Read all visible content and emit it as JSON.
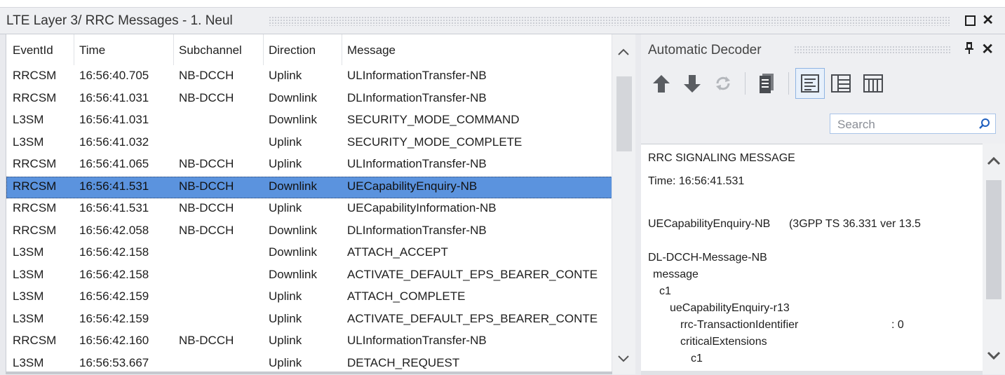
{
  "window": {
    "title": "LTE Layer 3/ RRC Messages - 1. Neul",
    "restore_icon": "restore-icon",
    "close_icon": "close-icon"
  },
  "grid": {
    "columns": [
      "EventId",
      "Time",
      "Subchannel",
      "Direction",
      "Message"
    ],
    "rows": [
      {
        "event": "RRCSM",
        "time": "16:56:40.705",
        "sub": "NB-DCCH",
        "dir": "Uplink",
        "msg": "ULInformationTransfer-NB"
      },
      {
        "event": "RRCSM",
        "time": "16:56:41.031",
        "sub": "NB-DCCH",
        "dir": "Downlink",
        "msg": "DLInformationTransfer-NB"
      },
      {
        "event": "L3SM",
        "time": "16:56:41.031",
        "sub": "",
        "dir": "Downlink",
        "msg": "SECURITY_MODE_COMMAND"
      },
      {
        "event": "L3SM",
        "time": "16:56:41.032",
        "sub": "",
        "dir": "Uplink",
        "msg": "SECURITY_MODE_COMPLETE"
      },
      {
        "event": "RRCSM",
        "time": "16:56:41.065",
        "sub": "NB-DCCH",
        "dir": "Uplink",
        "msg": "ULInformationTransfer-NB"
      },
      {
        "event": "RRCSM",
        "time": "16:56:41.531",
        "sub": "NB-DCCH",
        "dir": "Downlink",
        "msg": "UECapabilityEnquiry-NB",
        "selected": true
      },
      {
        "event": "RRCSM",
        "time": "16:56:41.531",
        "sub": "NB-DCCH",
        "dir": "Uplink",
        "msg": "UECapabilityInformation-NB"
      },
      {
        "event": "RRCSM",
        "time": "16:56:42.058",
        "sub": "NB-DCCH",
        "dir": "Downlink",
        "msg": "DLInformationTransfer-NB"
      },
      {
        "event": "L3SM",
        "time": "16:56:42.158",
        "sub": "",
        "dir": "Downlink",
        "msg": "ATTACH_ACCEPT"
      },
      {
        "event": "L3SM",
        "time": "16:56:42.158",
        "sub": "",
        "dir": "Downlink",
        "msg": "ACTIVATE_DEFAULT_EPS_BEARER_CONTE"
      },
      {
        "event": "L3SM",
        "time": "16:56:42.159",
        "sub": "",
        "dir": "Uplink",
        "msg": "ATTACH_COMPLETE"
      },
      {
        "event": "L3SM",
        "time": "16:56:42.159",
        "sub": "",
        "dir": "Uplink",
        "msg": "ACTIVATE_DEFAULT_EPS_BEARER_CONTE"
      },
      {
        "event": "RRCSM",
        "time": "16:56:42.160",
        "sub": "NB-DCCH",
        "dir": "Uplink",
        "msg": "ULInformationTransfer-NB"
      },
      {
        "event": "L3SM",
        "time": "16:56:53.667",
        "sub": "",
        "dir": "Uplink",
        "msg": "DETACH_REQUEST"
      }
    ]
  },
  "decoder": {
    "title": "Automatic Decoder",
    "toolbar": [
      "arrow-up-icon",
      "arrow-down-icon",
      "refresh-icon",
      "document-icon",
      "text-view-icon",
      "table-view-icon",
      "columns-view-icon"
    ],
    "search": {
      "placeholder": "Search",
      "value": ""
    },
    "lines": [
      "RRC SIGNALING MESSAGE",
      "Time: 16:56:41.531",
      "UECapabilityEnquiry-NB      (3GPP TS 36.331 ver 13.5",
      "DL-DCCH-Message-NB",
      "message",
      "c1",
      "ueCapabilityEnquiry-r13",
      "rrc-TransactionIdentifier",
      ": 0",
      "criticalExtensions",
      "c1"
    ]
  },
  "colors": {
    "selection": "#5b93de",
    "accent_blue": "#4a86d4"
  }
}
